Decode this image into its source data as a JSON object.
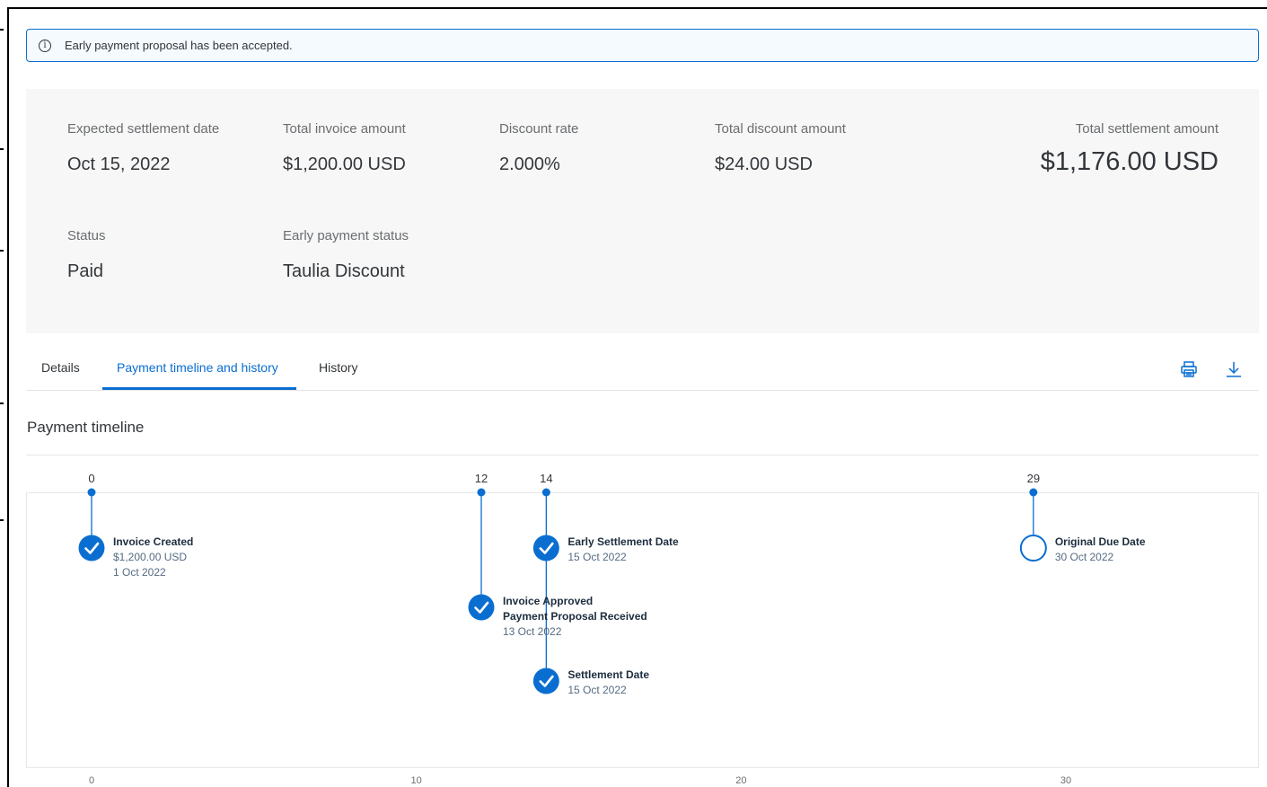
{
  "banner": {
    "icon": "info-icon",
    "message": "Early payment proposal has been accepted."
  },
  "summary": {
    "expected_settlement_date": {
      "label": "Expected settlement date",
      "value": "Oct 15, 2022"
    },
    "total_invoice_amount": {
      "label": "Total invoice amount",
      "value": "$1,200.00 USD"
    },
    "discount_rate": {
      "label": "Discount rate",
      "value": "2.000%"
    },
    "total_discount_amount": {
      "label": "Total discount amount",
      "value": "$24.00 USD"
    },
    "total_settlement_amount": {
      "label": "Total settlement amount",
      "value": "$1,176.00 USD"
    },
    "status": {
      "label": "Status",
      "value": "Paid"
    },
    "early_payment_status": {
      "label": "Early payment status",
      "value": "Taulia Discount"
    }
  },
  "tabs": [
    {
      "label": "Details",
      "active": false
    },
    {
      "label": "Payment timeline and history",
      "active": true
    },
    {
      "label": "History",
      "active": false
    }
  ],
  "toolbar": {
    "print_icon": "print-icon",
    "download_icon": "download-icon"
  },
  "timeline": {
    "title": "Payment timeline",
    "accent_color": "#0a6ed1",
    "axis_ticks": [
      0,
      10,
      20,
      30
    ],
    "x_range": [
      0,
      30
    ],
    "events": [
      {
        "day": 0,
        "lines": [
          "Invoice Created",
          "$1,200.00 USD",
          "1 Oct 2022"
        ],
        "done": true,
        "level": 0
      },
      {
        "day": 12,
        "lines": [
          "Invoice Approved",
          "Payment Proposal Received",
          "13 Oct 2022"
        ],
        "done": true,
        "level": 1
      },
      {
        "day": 14,
        "lines": [
          "Early Settlement Date",
          "15 Oct 2022"
        ],
        "done": true,
        "level": 0
      },
      {
        "day": 14,
        "lines": [
          "Settlement Date",
          "15 Oct 2022"
        ],
        "done": true,
        "level": 2
      },
      {
        "day": 29,
        "lines": [
          "Original Due Date",
          "30 Oct 2022"
        ],
        "done": false,
        "level": 0
      }
    ],
    "markers": [
      0,
      12,
      14,
      29
    ]
  }
}
